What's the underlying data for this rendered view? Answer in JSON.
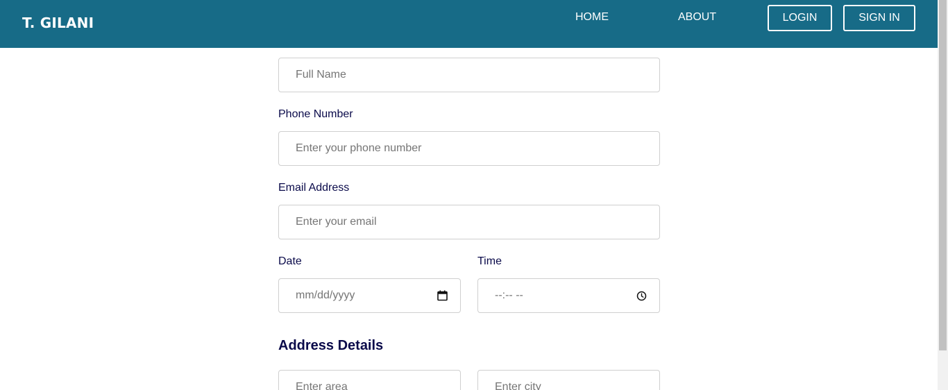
{
  "header": {
    "brand": "T. GILANI",
    "nav": {
      "home": "HOME",
      "about": "ABOUT",
      "login": "LOGIN",
      "signin": "SIGN IN"
    },
    "colors": {
      "bar": "#176b87",
      "text": "#ffffff"
    }
  },
  "form": {
    "full_name": {
      "placeholder": "Full Name"
    },
    "phone": {
      "label": "Phone Number",
      "placeholder": "Enter your phone number"
    },
    "email": {
      "label": "Email Address",
      "placeholder": "Enter your email"
    },
    "date": {
      "label": "Date",
      "placeholder": "mm/dd/yyyy",
      "icon": "calendar-icon"
    },
    "time": {
      "label": "Time",
      "placeholder": "--:-- --",
      "icon": "clock-icon"
    },
    "address": {
      "title": "Address Details",
      "area": {
        "placeholder": "Enter area"
      },
      "city": {
        "placeholder": "Enter city"
      }
    },
    "colors": {
      "label": "#0a0a4a",
      "border": "#cfcfcf",
      "placeholder": "#757575"
    }
  }
}
